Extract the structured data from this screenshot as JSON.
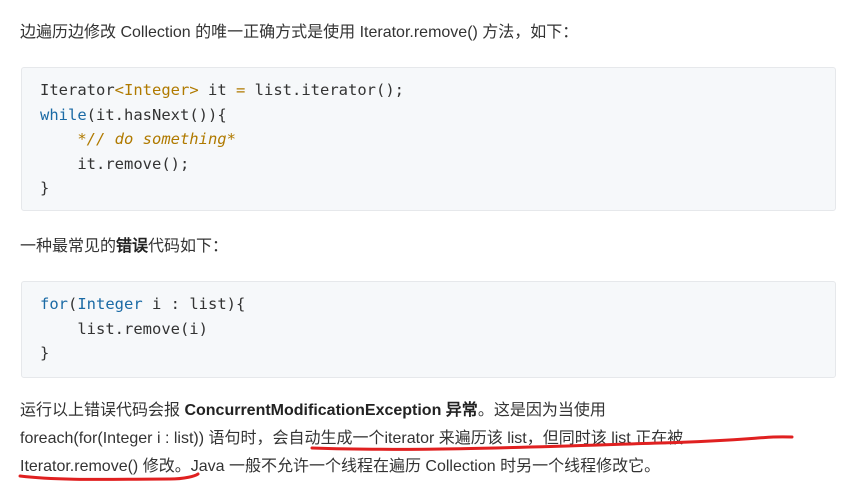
{
  "intro": {
    "text": "边遍历边修改 Collection 的唯一正确方式是使用 Iterator.remove() 方法，如下："
  },
  "code1": {
    "lines": [
      [
        {
          "t": "Iterator",
          "k": "plain"
        },
        {
          "t": "<",
          "k": "ty"
        },
        {
          "t": "Integer",
          "k": "ty"
        },
        {
          "t": ">",
          "k": "ty"
        },
        {
          "t": " it ",
          "k": "plain"
        },
        {
          "t": "=",
          "k": "ty"
        },
        {
          "t": " list.iterator();",
          "k": "plain"
        }
      ],
      [
        {
          "t": "while",
          "k": "kw"
        },
        {
          "t": "(it.hasNext()){",
          "k": "plain"
        }
      ],
      [
        {
          "t": "    ",
          "k": "plain"
        },
        {
          "t": "*// do something*",
          "k": "cm"
        }
      ],
      [
        {
          "t": "    it.remove();",
          "k": "plain"
        }
      ],
      [
        {
          "t": "}",
          "k": "plain"
        }
      ]
    ]
  },
  "middle": {
    "prefix": "一种最常见的",
    "bold": "错误",
    "suffix": "代码如下："
  },
  "code2": {
    "lines": [
      [
        {
          "t": "for",
          "k": "kw"
        },
        {
          "t": "(",
          "k": "plain"
        },
        {
          "t": "Integer",
          "k": "kw"
        },
        {
          "t": " i : list){",
          "k": "plain"
        }
      ],
      [
        {
          "t": "    list.remove(i)",
          "k": "plain"
        }
      ],
      [
        {
          "t": "}",
          "k": "plain"
        }
      ]
    ]
  },
  "outro": {
    "line1_prefix": "运行以上错误代码会报 ",
    "line1_bold": "ConcurrentModificationException 异常",
    "line1_suffix": "。这是因为当使用",
    "line2": "foreach(for(Integer i : list)) 语句时，会自动生成一个iterator 来遍历该 list，但同时该 list 正在被",
    "line3": "Iterator.remove() 修改。Java 一般不允许一个线程在遍历 Collection 时另一个线程修改它。"
  },
  "colors": {
    "keyword": "#1a6aa5",
    "type": "#b07a00",
    "annotation": "#e02020",
    "code_bg": "#f6f8fa"
  }
}
